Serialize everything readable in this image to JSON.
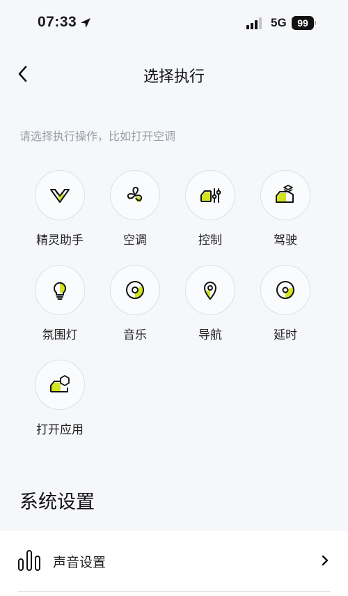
{
  "status": {
    "time": "07:33",
    "network": "5G",
    "battery": "99"
  },
  "header": {
    "title": "选择执行"
  },
  "hint": "请选择执行操作，比如打开空调",
  "actions": [
    {
      "label": "精灵助手",
      "icon": "assistant-icon"
    },
    {
      "label": "空调",
      "icon": "fan-icon"
    },
    {
      "label": "控制",
      "icon": "car-control-icon"
    },
    {
      "label": "驾驶",
      "icon": "drive-icon"
    },
    {
      "label": "氛围灯",
      "icon": "bulb-icon"
    },
    {
      "label": "音乐",
      "icon": "music-icon"
    },
    {
      "label": "导航",
      "icon": "location-pin-icon"
    },
    {
      "label": "延时",
      "icon": "timer-icon"
    },
    {
      "label": "打开应用",
      "icon": "open-app-icon"
    }
  ],
  "section": {
    "title": "系统设置"
  },
  "settings": [
    {
      "label": "声音设置",
      "icon": "sound-bars-icon"
    }
  ],
  "colors": {
    "accent": "#d4e31f",
    "background": "#f6f7fa"
  }
}
